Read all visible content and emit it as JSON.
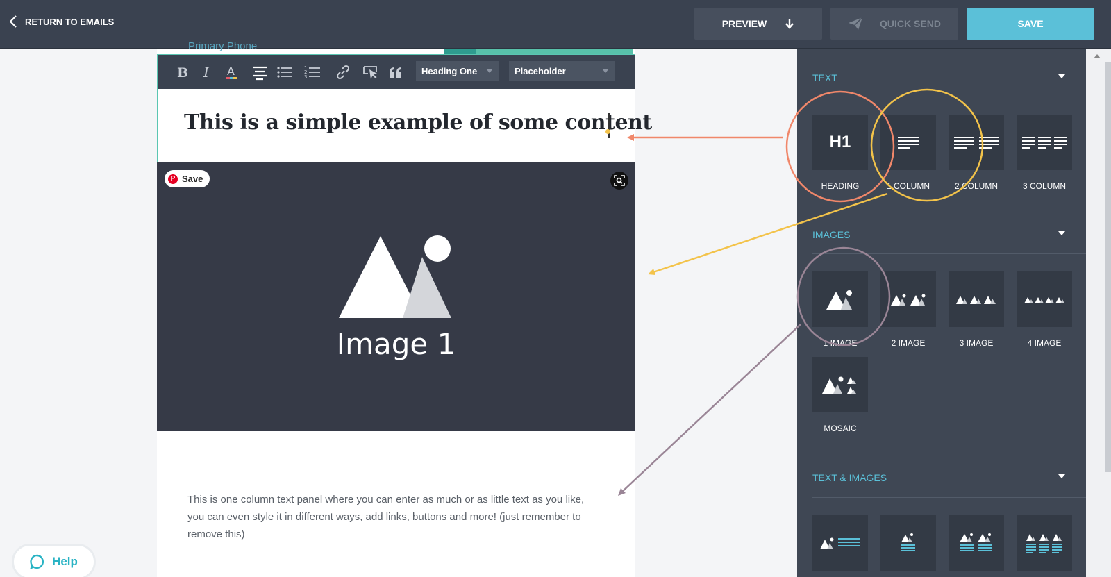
{
  "topbar": {
    "back_label": "RETURN TO EMAILS",
    "preview_label": "PREVIEW",
    "quick_send_label": "QUICK SEND",
    "save_label": "SAVE"
  },
  "canvas": {
    "peek_text": "Primary Phone",
    "editor": {
      "style_select": "Heading One",
      "placeholder_select": "Placeholder",
      "heading_text": "This is a simple example of some content"
    },
    "image_block": {
      "pin_save_label": "Save",
      "image_label": "Image 1"
    },
    "body_text": "This is one column text panel where you can enter as much or as little text as you like, you can even style it in different ways, add links, buttons and more! (just remember to remove this)"
  },
  "sidebar": {
    "text_section": {
      "title": "TEXT",
      "items": [
        "HEADING",
        "1 COLUMN",
        "2 COLUMN",
        "3 COLUMN"
      ],
      "heading_tile_glyph": "H1"
    },
    "images_section": {
      "title": "IMAGES",
      "items": [
        "1 IMAGE",
        "2 IMAGE",
        "3 IMAGE",
        "4 IMAGE",
        "MOSAIC"
      ]
    },
    "text_images_section": {
      "title": "TEXT & IMAGES"
    }
  },
  "help_label": "Help",
  "colors": {
    "topbar": "#3a4250",
    "accent": "#5bc0d8",
    "sidebar": "#3f4754",
    "tile": "#333a45",
    "image_bg": "#363a47",
    "annotation_orange": "#f0876a",
    "annotation_yellow": "#f3c34a",
    "annotation_purple": "#9a8596"
  }
}
